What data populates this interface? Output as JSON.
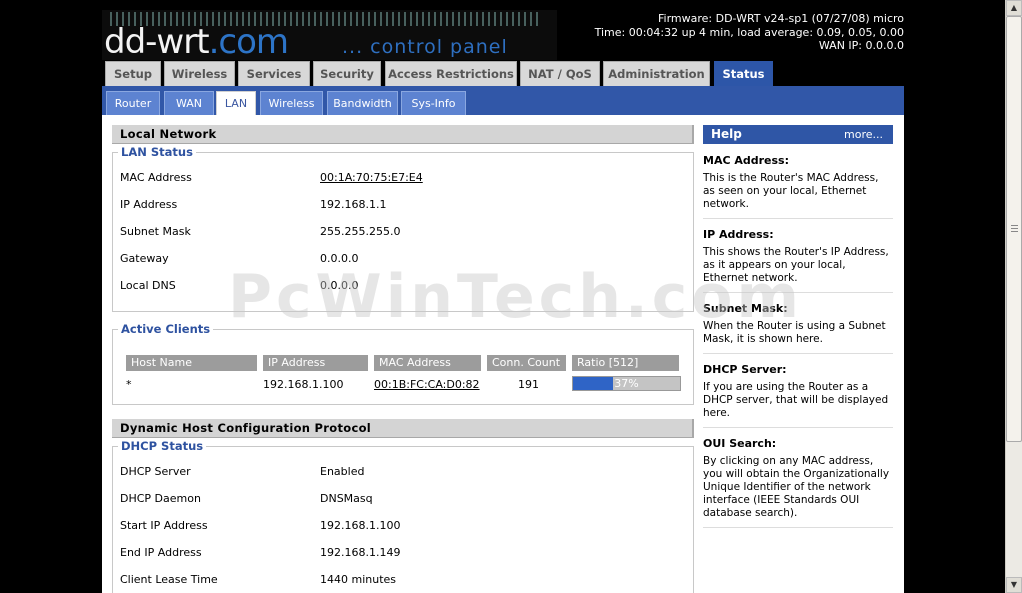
{
  "header": {
    "logo_text": "dd-wrt",
    "logo_suffix": ".com",
    "tagline": "... control panel",
    "firmware": "Firmware: DD-WRT v24-sp1 (07/27/08) micro",
    "time": "Time: 00:04:32 up 4 min, load average: 0.09, 0.05, 0.00",
    "wan_ip": "WAN IP: 0.0.0.0"
  },
  "main_tabs": [
    "Setup",
    "Wireless",
    "Services",
    "Security",
    "Access Restrictions",
    "NAT / QoS",
    "Administration",
    "Status"
  ],
  "active_main_tab": "Status",
  "sub_tabs": [
    "Router",
    "WAN",
    "LAN",
    "Wireless",
    "Bandwidth",
    "Sys-Info"
  ],
  "active_sub_tab": "LAN",
  "local_network": {
    "title": "Local Network",
    "lan_status": {
      "legend": "LAN Status",
      "rows": [
        {
          "label": "MAC Address",
          "value": "00:1A:70:75:E7:E4"
        },
        {
          "label": "IP Address",
          "value": "192.168.1.1"
        },
        {
          "label": "Subnet Mask",
          "value": "255.255.255.0"
        },
        {
          "label": "Gateway",
          "value": "0.0.0.0"
        },
        {
          "label": "Local DNS",
          "value": "0.0.0.0"
        }
      ]
    },
    "active_clients": {
      "legend": "Active Clients",
      "columns": [
        "Host Name",
        "IP Address",
        "MAC Address",
        "Conn. Count",
        "Ratio [512]"
      ],
      "rows": [
        {
          "host": "*",
          "ip": "192.168.1.100",
          "mac": "00:1B:FC:CA:D0:82",
          "conn": "191",
          "ratio_text": "37%",
          "ratio_fraction": 0.37
        }
      ]
    }
  },
  "dhcp": {
    "title": "Dynamic Host Configuration Protocol",
    "status": {
      "legend": "DHCP Status",
      "rows": [
        {
          "label": "DHCP Server",
          "value": "Enabled"
        },
        {
          "label": "DHCP Daemon",
          "value": "DNSMasq"
        },
        {
          "label": "Start IP Address",
          "value": "192.168.1.100"
        },
        {
          "label": "End IP Address",
          "value": "192.168.1.149"
        },
        {
          "label": "Client Lease Time",
          "value": "1440 minutes"
        }
      ]
    }
  },
  "help": {
    "title": "Help",
    "more": "more...",
    "items": [
      {
        "heading": "MAC Address:",
        "body": "This is the Router's MAC Address, as seen on your local, Ethernet network."
      },
      {
        "heading": "IP Address:",
        "body": "This shows the Router's IP Address, as it appears on your local, Ethernet network."
      },
      {
        "heading": "Subnet Mask:",
        "body": "When the Router is using a Subnet Mask, it is shown here."
      },
      {
        "heading": "DHCP Server:",
        "body": "If you are using the Router as a DHCP server, that will be displayed here."
      },
      {
        "heading": "OUI Search:",
        "body": "By clicking on any MAC address, you will obtain the Organizationally Unique Identifier of the network interface (IEEE Standards OUI database search)."
      }
    ]
  },
  "watermark": "PcWinTech.com",
  "colors": {
    "accent": "#2f56a6",
    "tab_inactive": "#d8d8d8",
    "ratio_fill": "#2f64c6"
  }
}
